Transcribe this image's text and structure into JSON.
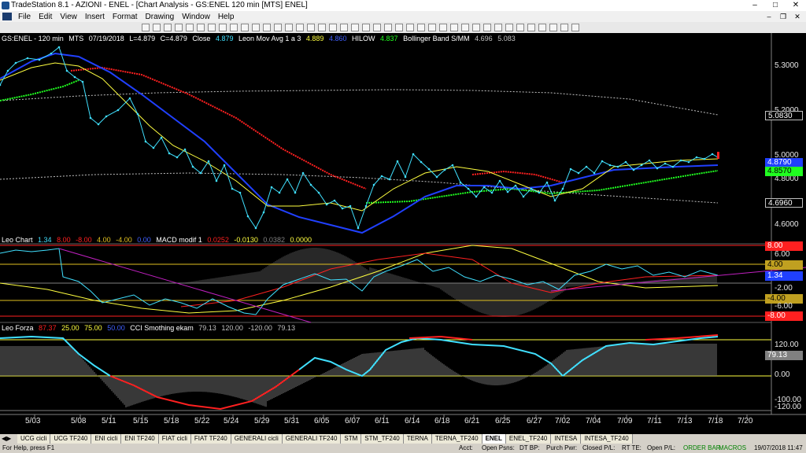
{
  "window": {
    "title": "TradeStation 8.1 - AZIONI - ENEL - [Chart Analysis - GS:ENEL  120 min  [MTS] ENEL]"
  },
  "menu": [
    "File",
    "Edit",
    "View",
    "Insert",
    "Format",
    "Drawing",
    "Window",
    "Help"
  ],
  "price_header": {
    "symbol": "GS:ENEL - 120 min",
    "mts": "MTS",
    "date": "07/19/2018",
    "l": "L=4.879",
    "c": "C=4.879",
    "close_label": "Close",
    "close_val": "4.879",
    "leon_label": "Leon Mov Avg 1 a 3",
    "leon_v1": "4.889",
    "leon_v2": "4.860",
    "hilow_label": "HILOW",
    "hilow_val": "4.837",
    "bb_label": "Bollinger Band S/MM",
    "bb_v1": "4.696",
    "bb_v2": "5.083"
  },
  "macd_header": {
    "name": "Leo Chart",
    "v1": "1.34",
    "v2": "8.00",
    "v3": "-8.00",
    "v4": "4.00",
    "v5": "-4.00",
    "v6": "0.00",
    "macd_label": "MACD modif 1",
    "m1": "0.0252",
    "m2": "-0.0130",
    "m3": "0.0382",
    "m4": "0.0000"
  },
  "cci_header": {
    "name": "Leo Forza",
    "v1": "87.37",
    "v2": "25.00",
    "v3": "75.00",
    "v4": "50.00",
    "cci_label": "CCI Smothing ekam",
    "c1": "79.13",
    "c2": "120.00",
    "c3": "-120.00",
    "c4": "79.13"
  },
  "price_axis": {
    "ticks": [
      "5.3000",
      "5.2000",
      "5.0830",
      "5.0000",
      "4.8790",
      "4.8570",
      "4.8000",
      "4.6960",
      "4.6000"
    ],
    "boxes": {
      "upper_bb": "5.0830",
      "close": "4.8790",
      "hilow": "4.8570",
      "lower_bb": "4.6960"
    }
  },
  "macd_axis": [
    "8.00",
    "6.00",
    "4.00",
    "1.34",
    "-2.00",
    "-4.00",
    "-6.00",
    "-8.00"
  ],
  "cci_axis": [
    "120.00",
    "79.13",
    "0.00",
    "-100.00",
    "-120.00"
  ],
  "x_axis": [
    "5/03",
    "5/08",
    "5/11",
    "5/15",
    "5/18",
    "5/22",
    "5/24",
    "5/29",
    "5/31",
    "6/05",
    "6/07",
    "6/11",
    "6/14",
    "6/18",
    "6/21",
    "6/25",
    "6/27",
    "7/02",
    "7/04",
    "7/09",
    "7/11",
    "7/13",
    "7/18",
    "7/20"
  ],
  "tabs": [
    "UCG cicli",
    "UCG TF240",
    "ENI cicli",
    "ENI TF240",
    "FIAT cicli",
    "FIAT TF240",
    "GENERALI cicli",
    "GENERALI TF240",
    "STM",
    "STM_TF240",
    "TERNA",
    "TERNA_TF240",
    "ENEL",
    "ENEL_TF240",
    "INTESA",
    "INTESA_TF240"
  ],
  "active_tab": "ENEL",
  "status": {
    "help": "For Help, press F1",
    "acct": "Acct:",
    "open_psns": "Open Psns:",
    "dt_bp": "DT BP:",
    "purch_pwr": "Purch Pwr:",
    "closed_pl": "Closed P/L:",
    "rt_te": "RT TE:",
    "open_pl": "Open P/L:",
    "order_bar": "ORDER BAR",
    "macros": "MACROS",
    "clock": "19/07/2018 11:47"
  },
  "colors": {
    "bg": "#000000",
    "price": "#40e0ff",
    "leon_fast": "#ffff40",
    "leon_slow": "#2040ff",
    "hilow_red": "#ff2020",
    "hilow_green": "#20ff20",
    "bb": "#c0c0c0",
    "macd_red": "#ff2020",
    "macd_yellow": "#e0c020",
    "trend_magenta": "#c020c0",
    "cci_cyan": "#40e0ff",
    "cci_red": "#ff2020"
  }
}
